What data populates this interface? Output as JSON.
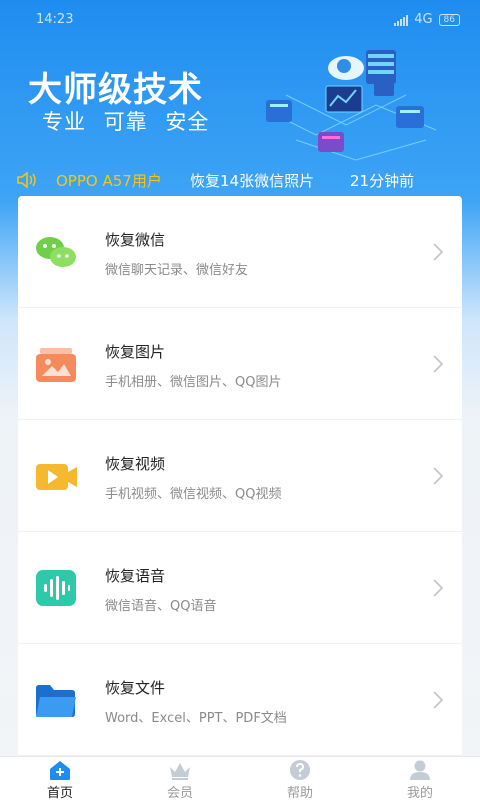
{
  "status": {
    "time": "14:23",
    "network": "4G",
    "battery": "86"
  },
  "banner": {
    "title": "大师级技术",
    "subtitle": "专业 可靠 安全"
  },
  "ticker": {
    "user": "OPPO A57用户",
    "message": "恢复14张微信照片",
    "time_ago": "21分钟前"
  },
  "items": [
    {
      "title": "恢复微信",
      "desc": "微信聊天记录、微信好友",
      "icon": "wechat-icon"
    },
    {
      "title": "恢复图片",
      "desc": "手机相册、微信图片、QQ图片",
      "icon": "photo-icon"
    },
    {
      "title": "恢复视频",
      "desc": "手机视频、微信视频、QQ视频",
      "icon": "video-icon"
    },
    {
      "title": "恢复语音",
      "desc": "微信语音、QQ语音",
      "icon": "audio-icon"
    },
    {
      "title": "恢复文件",
      "desc": "Word、Excel、PPT、PDF文档",
      "icon": "folder-icon"
    }
  ],
  "tabs": [
    {
      "label": "首页",
      "icon": "home-icon",
      "active": true
    },
    {
      "label": "会员",
      "icon": "crown-icon",
      "active": false
    },
    {
      "label": "帮助",
      "icon": "help-icon",
      "active": false
    },
    {
      "label": "我的",
      "icon": "profile-icon",
      "active": false
    }
  ],
  "colors": {
    "primary": "#1f8df0",
    "ticker_user": "#f5c518",
    "wechat": "#6fcf4a",
    "photo": "#f58a5c",
    "video": "#f5b82e",
    "audio": "#2ec9a8",
    "folder": "#2f8fe8"
  }
}
